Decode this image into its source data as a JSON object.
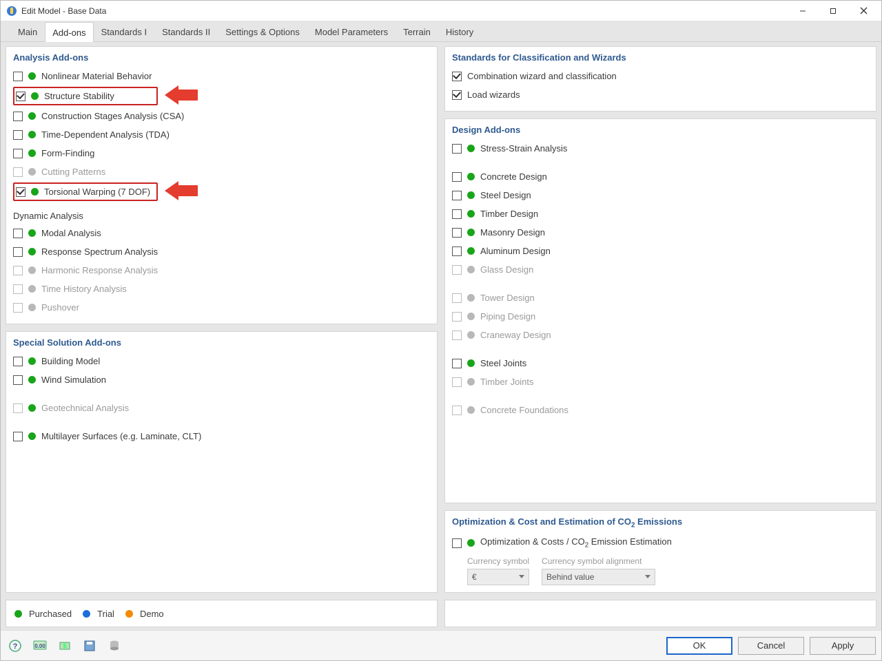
{
  "window": {
    "title": "Edit Model - Base Data"
  },
  "tabs": [
    "Main",
    "Add-ons",
    "Standards I",
    "Standards II",
    "Settings & Options",
    "Model Parameters",
    "Terrain",
    "History"
  ],
  "active_tab": 1,
  "panels": {
    "analysis": {
      "title": "Analysis Add-ons",
      "items1": [
        {
          "label": "Nonlinear Material Behavior",
          "checked": false,
          "dot": "green",
          "disabled": false,
          "hl": false
        },
        {
          "label": "Structure Stability",
          "checked": true,
          "dot": "green",
          "disabled": false,
          "hl": true
        },
        {
          "label": "Construction Stages Analysis (CSA)",
          "checked": false,
          "dot": "green",
          "disabled": false,
          "hl": false
        },
        {
          "label": "Time-Dependent Analysis (TDA)",
          "checked": false,
          "dot": "green",
          "disabled": false,
          "hl": false
        },
        {
          "label": "Form-Finding",
          "checked": false,
          "dot": "green",
          "disabled": false,
          "hl": false
        },
        {
          "label": "Cutting Patterns",
          "checked": false,
          "dot": "gray",
          "disabled": true,
          "hl": false
        },
        {
          "label": "Torsional Warping (7 DOF)",
          "checked": true,
          "dot": "green",
          "disabled": false,
          "hl": true
        }
      ],
      "dyn_label": "Dynamic Analysis",
      "items2": [
        {
          "label": "Modal Analysis",
          "checked": false,
          "dot": "green",
          "disabled": false
        },
        {
          "label": "Response Spectrum Analysis",
          "checked": false,
          "dot": "green",
          "disabled": false
        },
        {
          "label": "Harmonic Response Analysis",
          "checked": false,
          "dot": "gray",
          "disabled": true
        },
        {
          "label": "Time History Analysis",
          "checked": false,
          "dot": "gray",
          "disabled": true
        },
        {
          "label": "Pushover",
          "checked": false,
          "dot": "gray",
          "disabled": true
        }
      ]
    },
    "special": {
      "title": "Special Solution Add-ons",
      "items": [
        {
          "label": "Building Model",
          "checked": false,
          "dot": "green",
          "disabled": false,
          "gap": false
        },
        {
          "label": "Wind Simulation",
          "checked": false,
          "dot": "green",
          "disabled": false,
          "gap": false
        },
        {
          "label": "Geotechnical Analysis",
          "checked": false,
          "dot": "green",
          "disabled": true,
          "gap": true
        },
        {
          "label": "Multilayer Surfaces (e.g. Laminate, CLT)",
          "checked": false,
          "dot": "green",
          "disabled": false,
          "gap": true
        }
      ]
    },
    "standards": {
      "title": "Standards for Classification and Wizards",
      "items": [
        {
          "label": "Combination wizard and classification",
          "checked": true
        },
        {
          "label": "Load wizards",
          "checked": true
        }
      ]
    },
    "design": {
      "title": "Design Add-ons",
      "groups": [
        [
          {
            "label": "Stress-Strain Analysis",
            "checked": false,
            "dot": "green",
            "disabled": false
          }
        ],
        [
          {
            "label": "Concrete Design",
            "checked": false,
            "dot": "green",
            "disabled": false
          },
          {
            "label": "Steel Design",
            "checked": false,
            "dot": "green",
            "disabled": false
          },
          {
            "label": "Timber Design",
            "checked": false,
            "dot": "green",
            "disabled": false
          },
          {
            "label": "Masonry Design",
            "checked": false,
            "dot": "green",
            "disabled": false
          },
          {
            "label": "Aluminum Design",
            "checked": false,
            "dot": "green",
            "disabled": false
          },
          {
            "label": "Glass Design",
            "checked": false,
            "dot": "gray",
            "disabled": true
          }
        ],
        [
          {
            "label": "Tower Design",
            "checked": false,
            "dot": "gray",
            "disabled": true
          },
          {
            "label": "Piping Design",
            "checked": false,
            "dot": "gray",
            "disabled": true
          },
          {
            "label": "Craneway Design",
            "checked": false,
            "dot": "gray",
            "disabled": true
          }
        ],
        [
          {
            "label": "Steel Joints",
            "checked": false,
            "dot": "green",
            "disabled": false
          },
          {
            "label": "Timber Joints",
            "checked": false,
            "dot": "gray",
            "disabled": true
          }
        ],
        [
          {
            "label": "Concrete Foundations",
            "checked": false,
            "dot": "gray",
            "disabled": true
          }
        ]
      ]
    },
    "optimization": {
      "title": "Optimization & Cost and Estimation of CO₂ Emissions",
      "item": {
        "label": "Optimization & Costs / CO₂ Emission Estimation",
        "checked": false,
        "dot": "green"
      },
      "currency_label": "Currency symbol",
      "currency_value": "€",
      "align_label": "Currency symbol alignment",
      "align_value": "Behind value"
    }
  },
  "legend": {
    "purchased": "Purchased",
    "trial": "Trial",
    "demo": "Demo"
  },
  "buttons": {
    "ok": "OK",
    "cancel": "Cancel",
    "apply": "Apply"
  }
}
